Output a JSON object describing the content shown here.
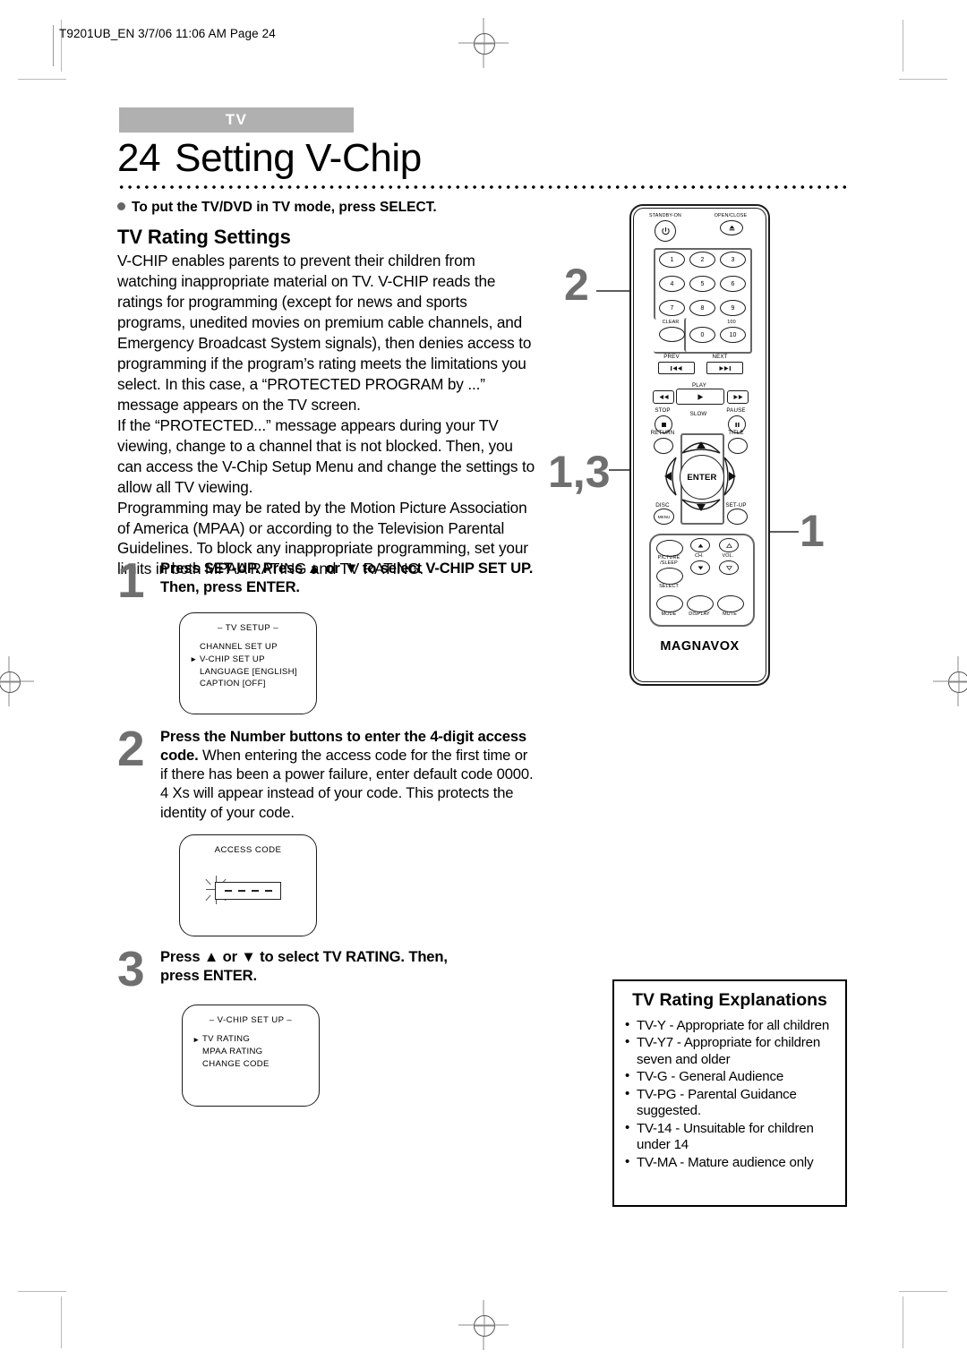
{
  "header": {
    "file_info": "T9201UB_EN 3/7/06 11:06 AM Page 24"
  },
  "title": {
    "tab_label": "TV",
    "page_number": "24",
    "page_title": "Setting V-Chip"
  },
  "intro": {
    "bullet": "To put the TV/DVD in TV mode, press SELECT.",
    "section_heading": "TV Rating Settings",
    "paragraphs": [
      "V-CHIP enables parents to prevent their children from watching inappropriate material on TV. V-CHIP reads the ratings for programming (except for news and sports programs, unedited movies on premium cable channels, and Emergency Broadcast System signals), then denies access to programming if the program’s rating meets the limitations you select. In this case, a “PROTECTED PROGRAM by ...” message appears on the TV screen.",
      "If the “PROTECTED...” message appears during your TV viewing, change to a channel that is not blocked. Then, you can access the V-Chip Setup Menu and change the settings to allow all TV viewing.",
      "Programming may be rated by the Motion Picture Association of America (MPAA) or according to the Television Parental Guidelines. To block any inappropriate programming, set your limits in both MPAA RATING and TV RATING."
    ]
  },
  "steps": [
    {
      "number": "1",
      "text_bold": "Press SET-UP. Press ▲ or ▼ to select V-CHIP SET UP.  Then, press ENTER.",
      "screen": {
        "title": "– TV SETUP –",
        "items": [
          {
            "cursor": "",
            "label": "CHANNEL SET UP"
          },
          {
            "cursor": "►",
            "label": "V-CHIP SET UP"
          },
          {
            "cursor": "",
            "label": "LANGUAGE  [ENGLISH]"
          },
          {
            "cursor": "",
            "label": "CAPTION  [OFF]"
          }
        ]
      }
    },
    {
      "number": "2",
      "text_bold": "Press the Number buttons to enter the 4-digit access code.",
      "text_rest": " When entering the access code for the first time or if there has been a power failure, enter default code 0000. 4 Xs will appear instead of your code. This protects the identity of your code.",
      "screen": {
        "title": "ACCESS CODE",
        "code_digits": "– – – –"
      }
    },
    {
      "number": "3",
      "text_bold": "Press ▲ or ▼ to select TV RATING. Then, press ENTER.",
      "screen": {
        "title": "– V-CHIP SET UP –",
        "items": [
          {
            "cursor": "►",
            "label": "TV RATING"
          },
          {
            "cursor": "",
            "label": "MPAA RATING"
          },
          {
            "cursor": "",
            "label": "CHANGE CODE"
          }
        ]
      }
    }
  ],
  "explanations": {
    "heading": "TV Rating Explanations",
    "items": [
      "TV-Y - Appropriate for all children",
      "TV-Y7 - Appropriate for children seven and older",
      "TV-G - General Audience",
      "TV-PG - Parental Guidance suggested.",
      "TV-14 - Unsuitable for children under 14",
      "TV-MA - Mature audience only"
    ]
  },
  "callouts": [
    {
      "label": "2"
    },
    {
      "label": "1,3"
    },
    {
      "label": "1"
    }
  ],
  "remote": {
    "brand": "MAGNAVOX",
    "standby_label": "STANDBY-ON",
    "open_close_label": "OPEN/CLOSE",
    "numbers": [
      "1",
      "2",
      "3",
      "4",
      "5",
      "6",
      "7",
      "8",
      "9"
    ],
    "clear_label": "CLEAR",
    "zero_label": "0",
    "ten_label": "10",
    "hundred_label": "100",
    "prev_label": "PREV",
    "next_label": "NEXT",
    "play_label": "PLAY",
    "stop_label": "STOP",
    "slow_label": "SLOW",
    "pause_label": "PAUSE",
    "return_label": "RETURN",
    "title_label": "TITLE",
    "enter_label": "ENTER",
    "disc_label": "DISC",
    "menu_label": "MENU",
    "setup_label": "SET-UP",
    "picture_label": "PICTURE",
    "sleep_label": "/SLEEP",
    "select_label": "SELECT",
    "ch_label": "CH.",
    "vol_label": "VOL.",
    "mode_label": "MODE",
    "display_label": "DISPLAY",
    "mute_label": "MUTE"
  },
  "colors": {
    "tab_gray": "#b0b0b0",
    "callout_gray": "#6f6f6f",
    "ink": "#000000"
  }
}
